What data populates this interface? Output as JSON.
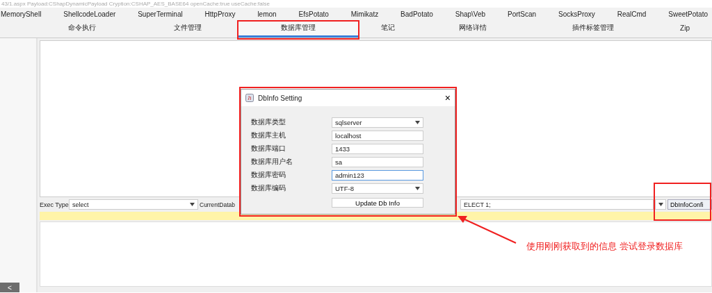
{
  "header": {
    "connection_info": "43/1.aspx Payload:CShapDynamicPayload Cryption:CSHAP_AES_BASE64 openCache:true useCache:false"
  },
  "plugin_tabs": [
    {
      "label": "MemoryShell"
    },
    {
      "label": "ShellcodeLoader"
    },
    {
      "label": "SuperTerminal"
    },
    {
      "label": "HttpProxy"
    },
    {
      "label": "lemon"
    },
    {
      "label": "EfsPotato"
    },
    {
      "label": "Mimikatz"
    },
    {
      "label": "BadPotato"
    },
    {
      "label": "Shap\\Veb"
    },
    {
      "label": "PortScan"
    },
    {
      "label": "SocksProxy"
    },
    {
      "label": "RealCmd"
    },
    {
      "label": "SweetPotato"
    }
  ],
  "main_tabs": [
    {
      "label": "命令执行",
      "selected": false
    },
    {
      "label": "文件管理",
      "selected": false
    },
    {
      "label": "数据库管理",
      "selected": true
    },
    {
      "label": "笔记",
      "selected": false
    },
    {
      "label": "网络详情",
      "selected": false
    },
    {
      "label": "插件标签管理",
      "selected": false
    },
    {
      "label": "Zip",
      "selected": false
    }
  ],
  "query_bar": {
    "exec_type_label": "Exec Type",
    "exec_type": "select",
    "current_db_label": "CurrentDatab",
    "sql": "ELECT 1;",
    "config_button": "DbInfoConfi"
  },
  "dialog": {
    "title": "DbInfo Setting",
    "close": "×",
    "fields": [
      {
        "label": "数据库类型",
        "kind": "select",
        "value": "sqlserver",
        "focused": false
      },
      {
        "label": "数据库主机",
        "kind": "text",
        "value": "localhost",
        "focused": false
      },
      {
        "label": "数据库端口",
        "kind": "text",
        "value": "1433",
        "focused": false
      },
      {
        "label": "数据库用户名",
        "kind": "text",
        "value": "sa",
        "focused": false
      },
      {
        "label": "数据库密码",
        "kind": "text",
        "value": "admin123",
        "focused": true
      },
      {
        "label": "数据库编码",
        "kind": "select",
        "value": "UTF-8",
        "focused": false
      }
    ],
    "submit_button": "Update Db Info"
  },
  "sidebar": {
    "collapse_button": "<"
  },
  "annotation": {
    "callout": "使用刚刚获取到的信息 尝试登录数据库"
  }
}
